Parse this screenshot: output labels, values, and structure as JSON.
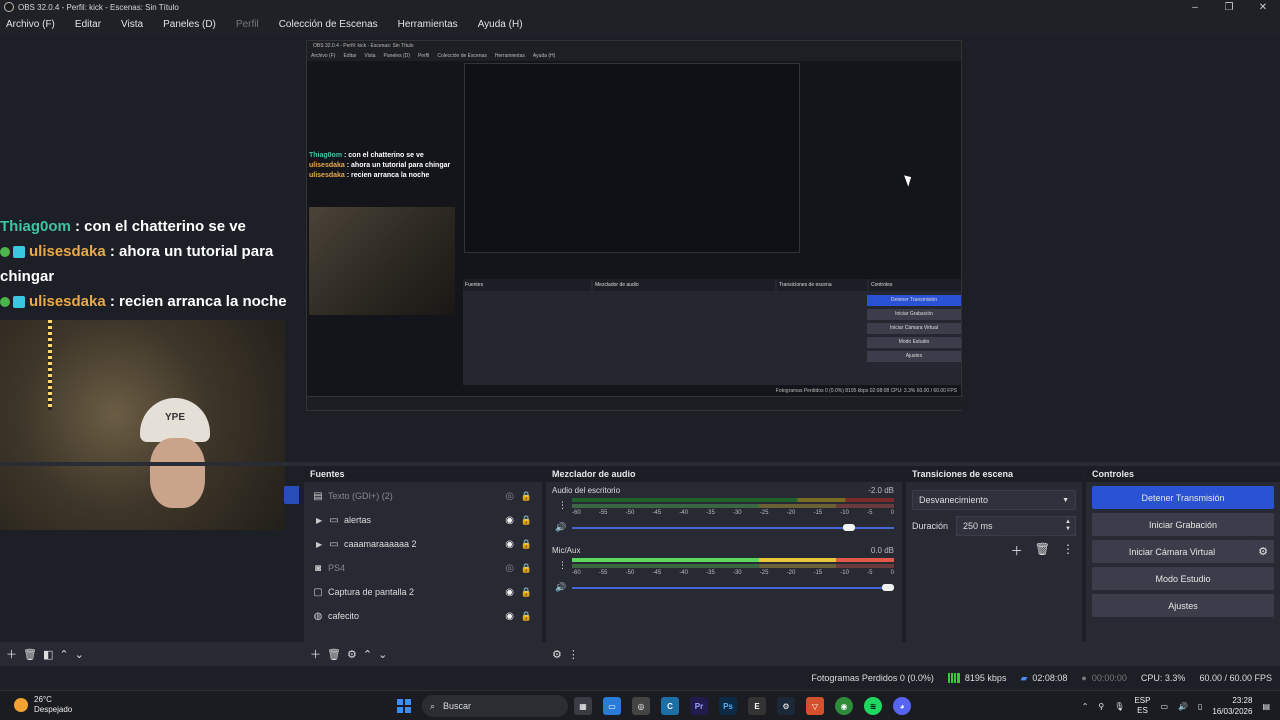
{
  "window": {
    "title": "OBS 32.0.4 - Perfil: kick - Escenas: Sin Título"
  },
  "menu": [
    "Archivo (F)",
    "Editar",
    "Vista",
    "Paneles (D)",
    "Perfil",
    "Colección de Escenas",
    "Herramientas",
    "Ayuda (H)"
  ],
  "chat": [
    {
      "user": "Thiag0om",
      "message": ": con el chatterino se ve"
    },
    {
      "user": "ulisesdaka",
      "message": ": ahora un tutorial para chingar"
    },
    {
      "user": "ulisesdaka",
      "message": ": recien arranca la noche"
    }
  ],
  "cap_text": "YPE",
  "sources": {
    "title": "Fuentes",
    "items": [
      {
        "label": "Texto (GDI+) (2)",
        "icon": "text-icon",
        "disabled": true
      },
      {
        "label": "alertas",
        "icon": "folder-icon",
        "group": true
      },
      {
        "label": "caaamaraaaaaa 2",
        "icon": "folder-icon",
        "group": true
      },
      {
        "label": "PS4",
        "icon": "camera-icon",
        "disabled": true
      },
      {
        "label": "Captura de pantalla 2",
        "icon": "monitor-icon"
      },
      {
        "label": "cafecito",
        "icon": "globe-icon"
      }
    ]
  },
  "mixer": {
    "title": "Mezclador de audio",
    "channels": [
      {
        "name": "Audio del escritorio",
        "db": "-2.0 dB",
        "volume": 0.88
      },
      {
        "name": "Mic/Aux",
        "db": "0.0 dB",
        "volume": 1.0
      }
    ],
    "ticks": [
      "-60",
      "-55",
      "-50",
      "-45",
      "-40",
      "-35",
      "-30",
      "-25",
      "-20",
      "-15",
      "-10",
      "-5",
      "0"
    ]
  },
  "transitions": {
    "title": "Transiciones de escena",
    "selected": "Desvanecimiento",
    "duration_label": "Duración",
    "duration_value": "250 ms"
  },
  "controls": {
    "title": "Controles",
    "stop_stream": "Detener Transmisión",
    "start_recording": "Iniciar Grabación",
    "virtual_cam": "Iniciar Cámara Virtual",
    "studio_mode": "Modo Estudio",
    "settings": "Ajustes"
  },
  "status": {
    "dropped": "Fotogramas Perdidos 0 (0.0%)",
    "bitrate": "8195 kbps",
    "stream_time": "02:08:08",
    "rec_time": "00:00:00",
    "cpu": "CPU: 3.3%",
    "fps": "60.00 / 60.00 FPS"
  },
  "taskbar": {
    "temp": "26°C",
    "weather": "Despejado",
    "search": "Buscar",
    "lang1": "ESP",
    "lang2": "ES",
    "time": "23:28",
    "date": "16/03/2026"
  },
  "nested": {
    "title": "OBS 32.0.4 - Perfil: kick - Escenas: Sin Título",
    "status": "Fotogramas Perdidos 0 (0.0%)   8195 kbps   02:08:08   CPU: 3.3%   60.00 / 60.00 FPS"
  }
}
